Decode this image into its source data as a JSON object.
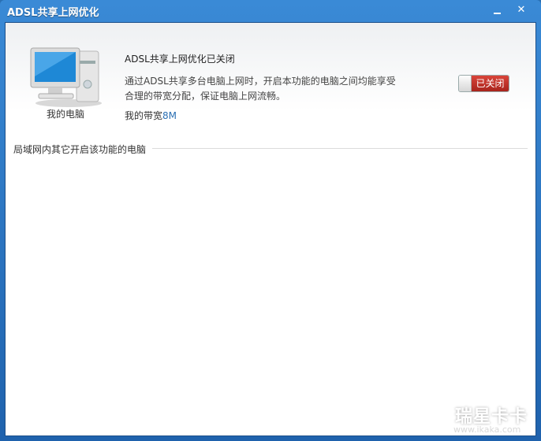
{
  "window": {
    "title": "ADSL共享上网优化"
  },
  "computer": {
    "label": "我的电脑"
  },
  "status": {
    "heading": "ADSL共享上网优化已关闭",
    "description": "通过ADSL共享多台电脑上网时，开启本功能的电脑之间均能享受合理的带宽分配，保证电脑上网流畅。",
    "bandwidth_label": "我的带宽",
    "bandwidth_value": "8M"
  },
  "toggle": {
    "label": "已关闭",
    "state": "off"
  },
  "lan_section": {
    "title": "局域网内其它开启该功能的电脑"
  },
  "watermark": {
    "brand": "瑞星卡卡",
    "url": "www.ikaka.com"
  },
  "colors": {
    "titlebar": "#2f7fcf",
    "accent": "#2a6fb3",
    "toggle_off": "#b8302a"
  }
}
